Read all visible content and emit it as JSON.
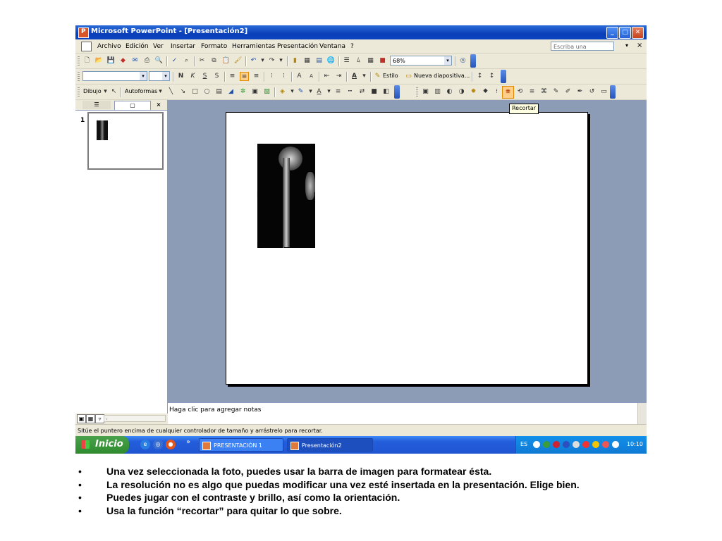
{
  "window": {
    "title": "Microsoft PowerPoint - [Presentación2]",
    "buttons": {
      "minimize": "_",
      "maximize": "□",
      "close": "✕"
    }
  },
  "menu": {
    "items": [
      "Archivo",
      "Edición",
      "Ver",
      "Insertar",
      "Formato",
      "Herramientas",
      "Presentación",
      "Ventana",
      "?"
    ],
    "help_placeholder": "Escriba una pregunta",
    "help_close": "×"
  },
  "toolbar": {
    "zoom": "68%",
    "font_bold": "N",
    "font_italic": "K",
    "font_underline": "S",
    "font_shadow": "S",
    "design_label": "Estilo",
    "new_slide_label": "Nueva diapositiva...",
    "draw_label": "Dibujo",
    "autoshapes_label": "Autoformas",
    "tooltip": "Recortar"
  },
  "left_panel": {
    "tab_outline": "☰",
    "tab_slides": "▢",
    "close": "×",
    "slide_number": "1"
  },
  "notes": {
    "placeholder": "Haga clic para agregar notas"
  },
  "status": {
    "text": "Sitúe el puntero encima de cualquier controlador de tamaño y arrástrelo para recortar."
  },
  "taskbar": {
    "start_label": "Inicio",
    "chevron": "»",
    "items": [
      "PRESENTACIÓN 1",
      "Presentación2"
    ],
    "language": "ES",
    "clock": "10:10"
  },
  "bullets": [
    "Una vez seleccionada la foto, puedes usar la barra de imagen para formatear ésta.",
    "La resolución no es algo que puedas modificar una vez esté insertada en la presentación. Elige bien.",
    "Puedes jugar con el contraste y brillo, así como la orientación.",
    "Usa la función “recortar” para quitar lo que sobre."
  ],
  "bullet_marker": "•",
  "colors": {
    "titlebar": "#0a3fb8",
    "workspace": "#8c9bb6",
    "taskbar": "#245edc",
    "start": "#2f8a2f",
    "crop_highlight": "#ffcf8a"
  }
}
